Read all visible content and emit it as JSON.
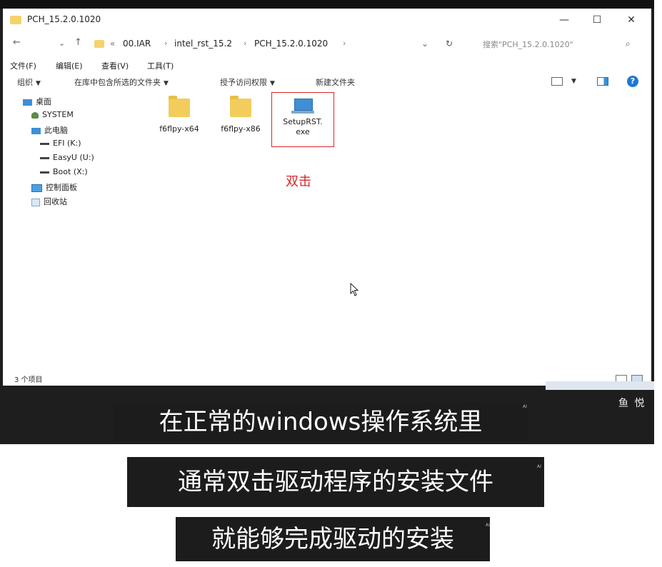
{
  "window": {
    "title": "PCH_15.2.0.1020",
    "controls": {
      "minimize": "—",
      "maximize": "☐",
      "close": "✕"
    }
  },
  "nav": {
    "back": "←",
    "history": "⌄",
    "up": "↑",
    "overflow": "«"
  },
  "breadcrumb": [
    "00.IAR",
    "intel_rst_15.2",
    "PCH_15.2.0.1020"
  ],
  "address_dropdown": "⌄",
  "refresh": "↻",
  "search": {
    "placeholder": "搜索\"PCH_15.2.0.1020\"",
    "icon": "⌕"
  },
  "menu": [
    "文件(F)",
    "编辑(E)",
    "查看(V)",
    "工具(T)"
  ],
  "commands": [
    "组织",
    "在库中包含所选的文件夹",
    "授予访问权限",
    "新建文件夹"
  ],
  "help_label": "?",
  "tree": [
    {
      "label": "桌面",
      "icon": "desktop-icon"
    },
    {
      "label": "SYSTEM",
      "icon": "user-icon"
    },
    {
      "label": "此电脑",
      "icon": "computer-icon"
    },
    {
      "label": "EFI (K:)",
      "icon": "drive-icon"
    },
    {
      "label": "EasyU (U:)",
      "icon": "drive-icon"
    },
    {
      "label": "Boot (X:)",
      "icon": "drive-icon"
    },
    {
      "label": "控制面板",
      "icon": "control-panel-icon"
    },
    {
      "label": "回收站",
      "icon": "recycle-bin-icon"
    }
  ],
  "files": [
    {
      "name": "f6flpy-x64",
      "type": "folder"
    },
    {
      "name": "f6flpy-x86",
      "type": "folder"
    },
    {
      "name": "SetupRST.\nexe",
      "type": "exe"
    }
  ],
  "annotation": "双击",
  "status": {
    "count": "3 个项目"
  },
  "watermark": {
    "logo_text": "鱼 悦"
  },
  "subtitles": [
    "在正常的windows操作系统里",
    "通常双击驱动程序的安装文件",
    "就能够完成驱动的安装"
  ],
  "ai_mark": "AI",
  "colors": {
    "accent_red": "#d8262b",
    "folder": "#f2cd5c",
    "subtitle_bg": "#1c1c1c"
  }
}
